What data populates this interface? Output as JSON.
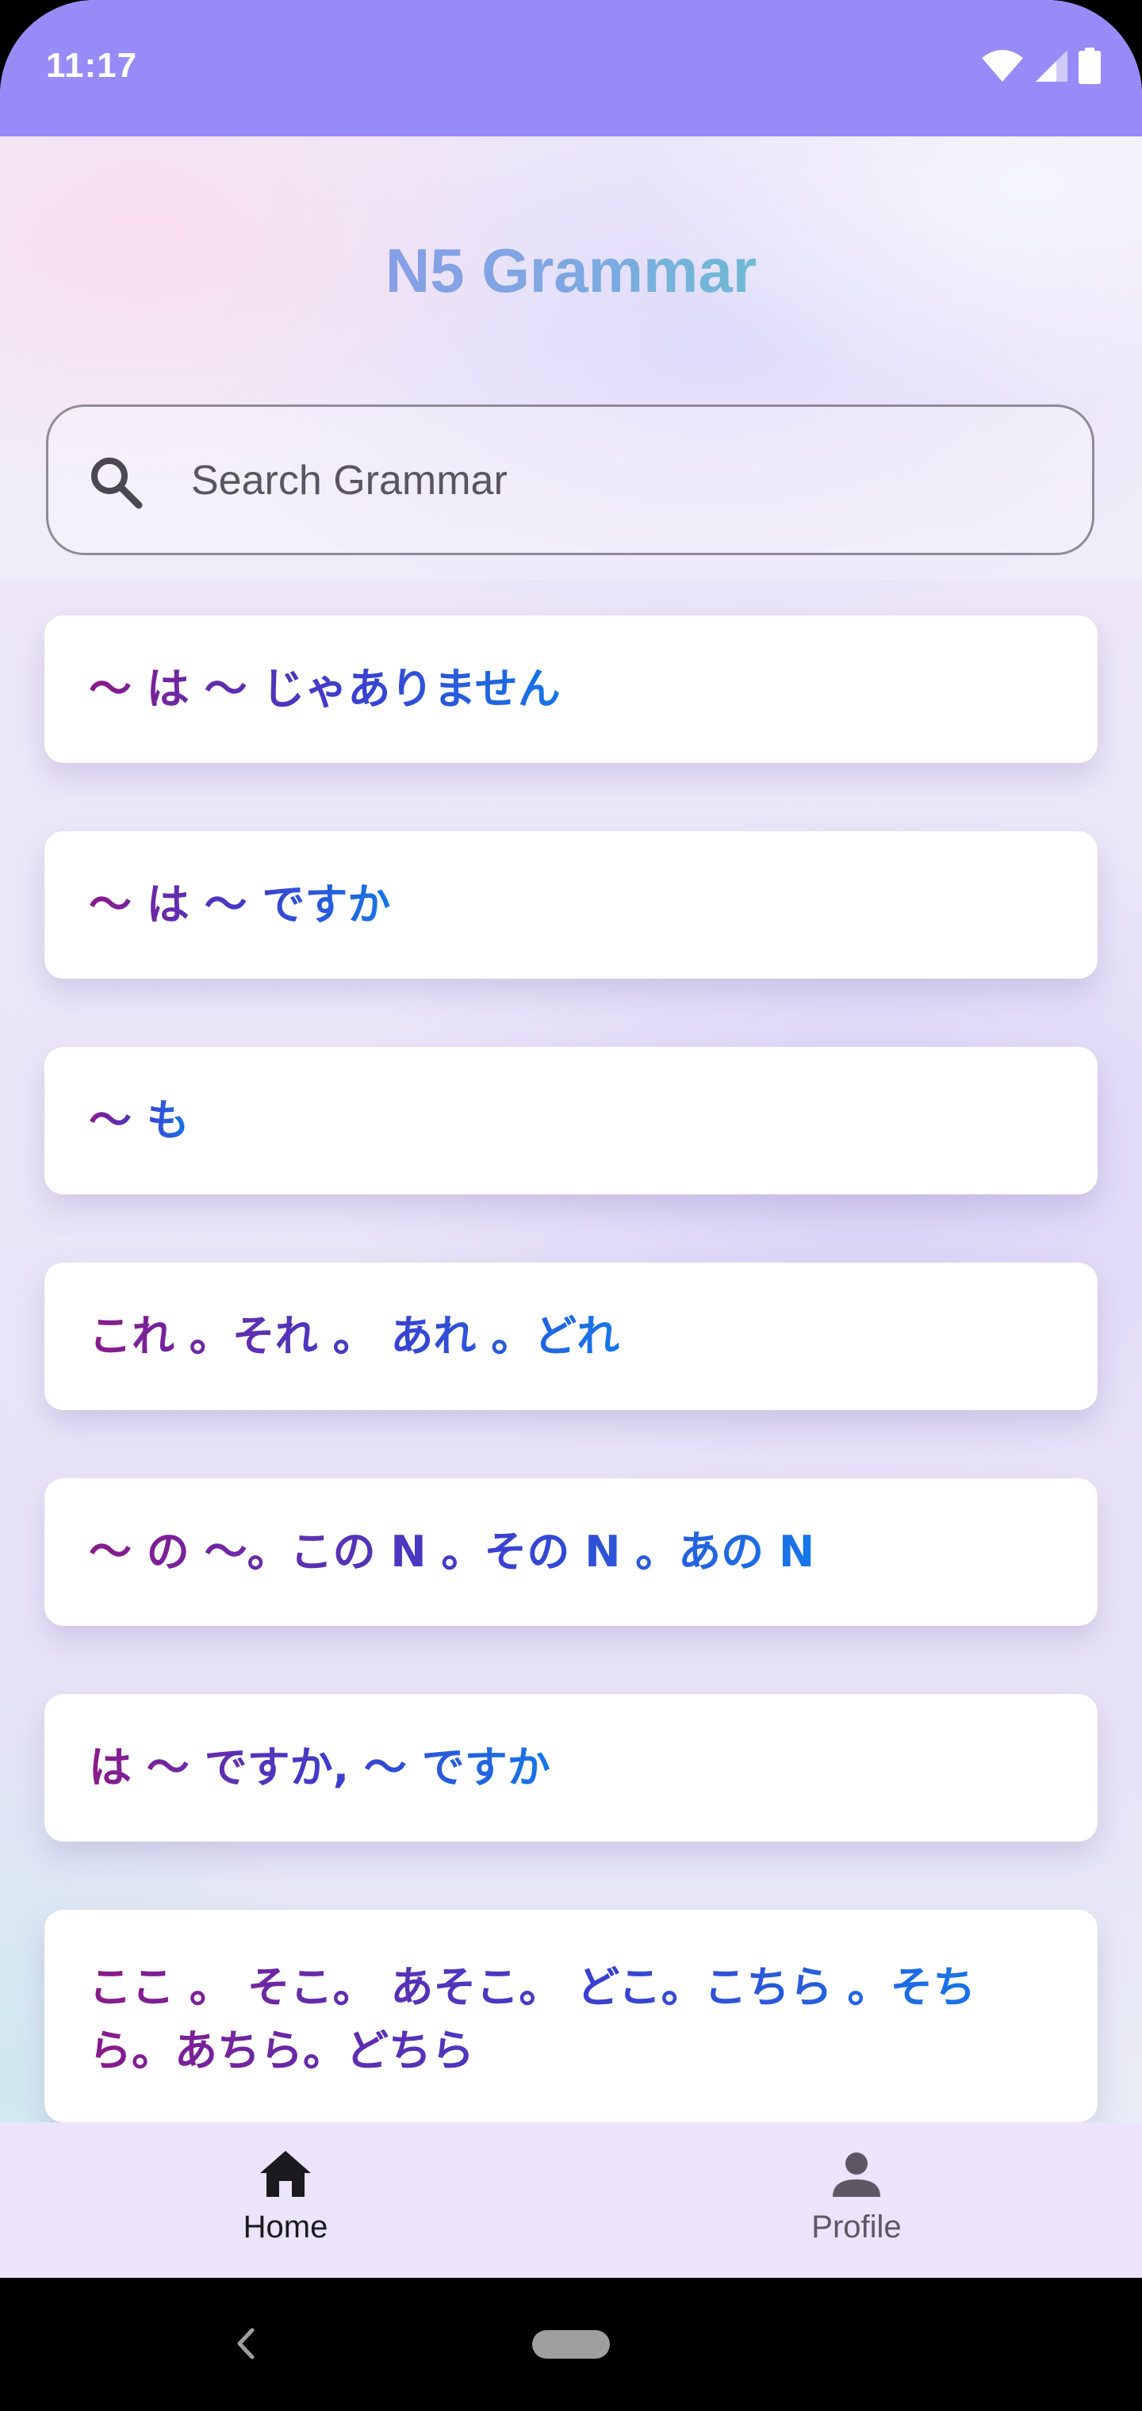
{
  "status_bar": {
    "time": "11:17"
  },
  "header": {
    "title": "N5 Grammar"
  },
  "search": {
    "placeholder": "Search Grammar",
    "value": ""
  },
  "grammar_items": [
    "〜 は 〜 じゃありません",
    "〜 は 〜 ですか",
    "〜 も",
    "これ 。それ 。 あれ 。どれ",
    "〜 の 〜。この N 。その N 。あの N",
    "は 〜 ですか, 〜 ですか",
    "ここ 。 そこ。 あそこ。 どこ。こちら 。そちら。あちら。どちら"
  ],
  "bottom_nav": {
    "home_label": "Home",
    "profile_label": "Profile"
  },
  "colors": {
    "status_bar": "#978bf7",
    "nav_background": "#ebe4fb",
    "title_gradient_start": "#9a8ef0",
    "title_gradient_end": "#4fe3b8",
    "card_text_start": "#8a1a8a",
    "card_text_end": "#1677e8"
  }
}
